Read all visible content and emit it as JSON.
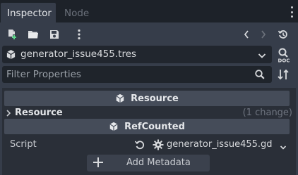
{
  "tabs": [
    {
      "label": "Inspector",
      "active": true
    },
    {
      "label": "Node",
      "active": false
    }
  ],
  "toolbar": {
    "icons": [
      "new-resource-icon",
      "open-folder-icon",
      "save-icon",
      "more-icon",
      "back-icon",
      "forward-icon",
      "history-icon"
    ]
  },
  "resource": {
    "name": "generator_issue455.tres",
    "doc_label": "DOC"
  },
  "filter": {
    "placeholder": "Filter Properties",
    "value": ""
  },
  "sections": {
    "resource_header": "Resource",
    "resource_group": "Resource",
    "resource_changes": "(1 change)",
    "refcounted_header": "RefCounted"
  },
  "script": {
    "label": "Script",
    "value": "generator_issue455.gd"
  },
  "add_metadata": "Add Metadata",
  "colors": {
    "background": "#21262e",
    "panel": "#363d4a",
    "header": "#454c59",
    "text": "#cdcfd2",
    "muted": "#6f7580"
  }
}
